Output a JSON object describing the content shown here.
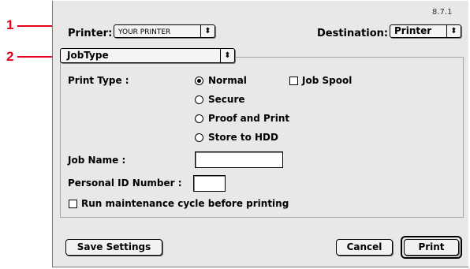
{
  "version": "8.7.1",
  "callouts": [
    "1",
    "2"
  ],
  "printer": {
    "label": "Printer:",
    "value": "YOUR PRINTER"
  },
  "destination": {
    "label": "Destination:",
    "value": "Printer"
  },
  "panel_popup": {
    "value": "JobType"
  },
  "print_type": {
    "label": "Print Type :",
    "options": [
      "Normal",
      "Secure",
      "Proof and Print",
      "Store to HDD"
    ],
    "selected": "Normal"
  },
  "job_spool": {
    "label": "Job Spool",
    "checked": false
  },
  "job_name": {
    "label": "Job Name :",
    "value": ""
  },
  "personal_id": {
    "label": "Personal ID Number :",
    "value": ""
  },
  "maintenance": {
    "label": "Run maintenance cycle before printing",
    "checked": false
  },
  "buttons": {
    "save": "Save Settings",
    "cancel": "Cancel",
    "print": "Print"
  },
  "colors": {
    "callout": "#e2001a",
    "dialog_bg": "#e8e8e8"
  }
}
